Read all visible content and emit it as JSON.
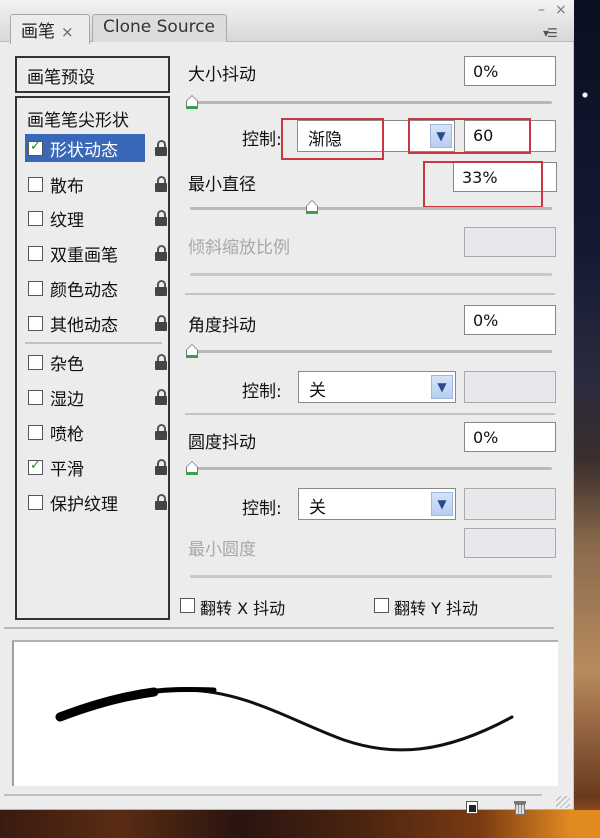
{
  "tabs": [
    {
      "label": "画笔",
      "close": "×",
      "active": true
    },
    {
      "label": "Clone Source",
      "active": false
    }
  ],
  "window_controls": {
    "minimize": "–",
    "close": "×",
    "menu": "▾☰"
  },
  "left_panel": {
    "preset_label": "画笔预设",
    "tip_shape_label": "画笔笔尖形状",
    "items_group1": [
      {
        "label": "形状动态",
        "checked": true,
        "selected": true,
        "locked": false
      },
      {
        "label": "散布",
        "checked": false,
        "selected": false,
        "locked": false
      },
      {
        "label": "纹理",
        "checked": false,
        "selected": false,
        "locked": false
      },
      {
        "label": "双重画笔",
        "checked": false,
        "selected": false,
        "locked": false
      },
      {
        "label": "颜色动态",
        "checked": false,
        "selected": false,
        "locked": false
      },
      {
        "label": "其他动态",
        "checked": false,
        "selected": false,
        "locked": false
      }
    ],
    "items_group2": [
      {
        "label": "杂色",
        "checked": false,
        "locked": false
      },
      {
        "label": "湿边",
        "checked": false,
        "locked": false
      },
      {
        "label": "喷枪",
        "checked": false,
        "locked": false
      },
      {
        "label": "平滑",
        "checked": true,
        "locked": false
      },
      {
        "label": "保护纹理",
        "checked": false,
        "locked": false
      }
    ]
  },
  "shape_dynamics": {
    "size_jitter": {
      "label": "大小抖动",
      "value": "0%",
      "slider_percent": 0
    },
    "size_control": {
      "label": "控制:",
      "selected": "渐隐",
      "steps": "60"
    },
    "min_diameter": {
      "label": "最小直径",
      "value": "33%",
      "slider_percent": 33
    },
    "tilt_scale": {
      "label": "倾斜缩放比例",
      "value": "",
      "disabled": true
    },
    "angle_jitter": {
      "label": "角度抖动",
      "value": "0%",
      "slider_percent": 0
    },
    "angle_control": {
      "label": "控制:",
      "selected": "关",
      "extra": ""
    },
    "roundness_jitter": {
      "label": "圆度抖动",
      "value": "0%",
      "slider_percent": 0
    },
    "roundness_control": {
      "label": "控制:",
      "selected": "关",
      "extra": ""
    },
    "min_roundness": {
      "label": "最小圆度",
      "value": "",
      "disabled": true
    },
    "flip_x": {
      "label": "翻转 X 抖动",
      "checked": false
    },
    "flip_y": {
      "label": "翻转 Y 抖动",
      "checked": false
    }
  },
  "annotation_color": "#c8383e",
  "footer": {
    "new_brush_icon": "new-brush",
    "delete_icon": "trash"
  }
}
